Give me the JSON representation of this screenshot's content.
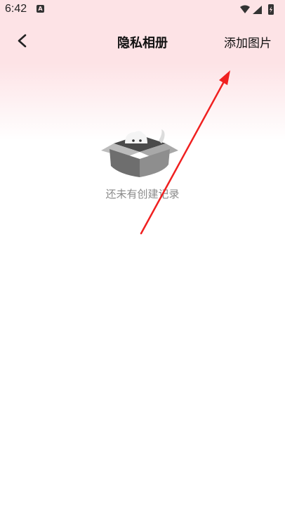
{
  "status_bar": {
    "time": "6:42",
    "notification_icon": "a-letter-icon",
    "icons": [
      "wifi-icon",
      "signal-icon",
      "battery-icon"
    ]
  },
  "header": {
    "title": "隐私相册",
    "back_icon": "chevron-left-icon",
    "add_photo_label": "添加图片"
  },
  "empty_state": {
    "illustration": "cat-in-box-icon",
    "message": "还未有创建记录"
  },
  "annotation": {
    "arrow_color": "#f02020"
  },
  "colors": {
    "header_background": "#fde3e6",
    "empty_text": "#8a8a8a"
  }
}
